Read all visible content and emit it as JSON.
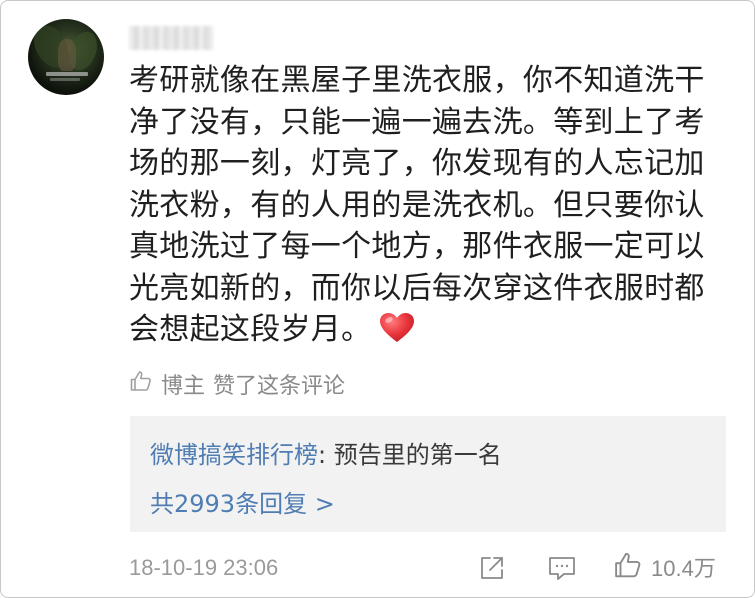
{
  "comment": {
    "lines": [
      "考研就像在黑屋子里洗衣服，你不知道洗干",
      "净了没有，只能一遍一遍去洗。等到上了考",
      "场的那一刻，灯亮了，你发现有的人忘记加",
      "洗衣粉，有的人用的是洗衣机。但只要你认",
      "真地洗过了每一个地方，那件衣服一定可以",
      "光亮如新的，而你以后每次穿这件衣服时都",
      "会想起这段岁月。"
    ],
    "emoji": "heart-emoji"
  },
  "liked_by_author": {
    "label": "博主",
    "text": "赞了这条评论"
  },
  "reply": {
    "author": "微博搞笑排行榜",
    "separator": ": ",
    "text": "预告里的第一名",
    "count_label": "共2993条回复 >"
  },
  "footer": {
    "timestamp": "18-10-19 23:06",
    "like_count": "10.4万"
  },
  "colors": {
    "link": "#4f7db3",
    "muted": "#8a8a8a",
    "heart": "#e8343a",
    "reply_bg": "#f2f2f2"
  }
}
